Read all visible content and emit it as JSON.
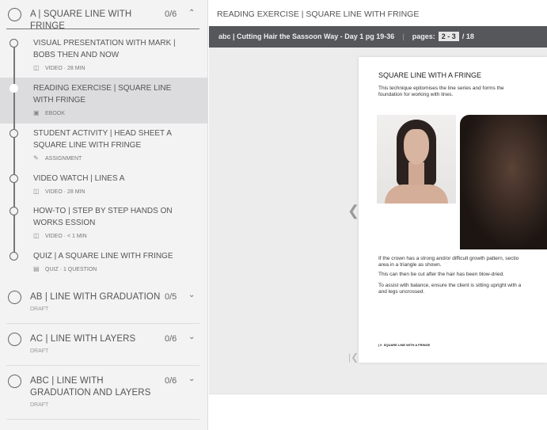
{
  "sidebar": {
    "sections": [
      {
        "title": "A | SQUARE LINE WITH FRINGE",
        "count": "0/6",
        "expanded": true,
        "items": [
          {
            "title": "VISUAL PRESENTATION WITH MARK | BOBS THEN AND NOW",
            "meta": "VIDEO · 28 MIN",
            "icon": "video-icon"
          },
          {
            "title": "READING EXERCISE | SQUARE LINE WITH FRINGE",
            "meta": "EBOOK",
            "icon": "ebook-icon",
            "active": true
          },
          {
            "title": "STUDENT ACTIVITY | HEAD SHEET A SQUARE LINE WITH FRINGE",
            "meta": "ASSIGNMENT",
            "icon": "assignment-icon"
          },
          {
            "title": "VIDEO WATCH | LINES A",
            "meta": "VIDEO · 28 MIN",
            "icon": "video-icon"
          },
          {
            "title": "HOW-TO | STEP BY STEP HANDS ON WORKS ESSION",
            "meta": "VIDEO · < 1 MIN",
            "icon": "video-icon"
          },
          {
            "title": "QUIZ | A SQUARE LINE WITH FRINGE",
            "meta": "QUIZ · 1 QUESTION",
            "icon": "quiz-icon"
          }
        ]
      },
      {
        "title": "AB | LINE WITH GRADUATION",
        "count": "0/5",
        "status": "DRAFT"
      },
      {
        "title": "AC | LINE WITH LAYERS",
        "count": "0/6",
        "status": "DRAFT"
      },
      {
        "title": "ABC | LINE WITH GRADUATION AND LAYERS",
        "count": "0/6",
        "status": "DRAFT"
      }
    ]
  },
  "main": {
    "header_title": "READING EXERCISE | SQUARE LINE WITH FRINGE",
    "book_title": "abc | Cutting Hair the Sassoon Way - Day 1 pg 19-36",
    "pages_label": "pages:",
    "pages_current": "2 - 3",
    "pages_total": "/ 18",
    "page": {
      "heading": "SQUARE LINE WITH A FRINGE",
      "intro_1": "This technique epitomises the line series and forms the",
      "intro_2": "foundation for working with lines.",
      "para1_1": "If the crown has a strong and/or difficult growth pattern, sectio",
      "para1_2": "area in a triangle as shown.",
      "para2": "This can then be cut after the hair has been blow-dried.",
      "para3_1": "To assist with balance, ensure the client is sitting upright with a",
      "para3_2": "and legs uncrossed.",
      "footer_num": "0",
      "footer": "SQUARE LINE WITH A FRINGE"
    }
  }
}
